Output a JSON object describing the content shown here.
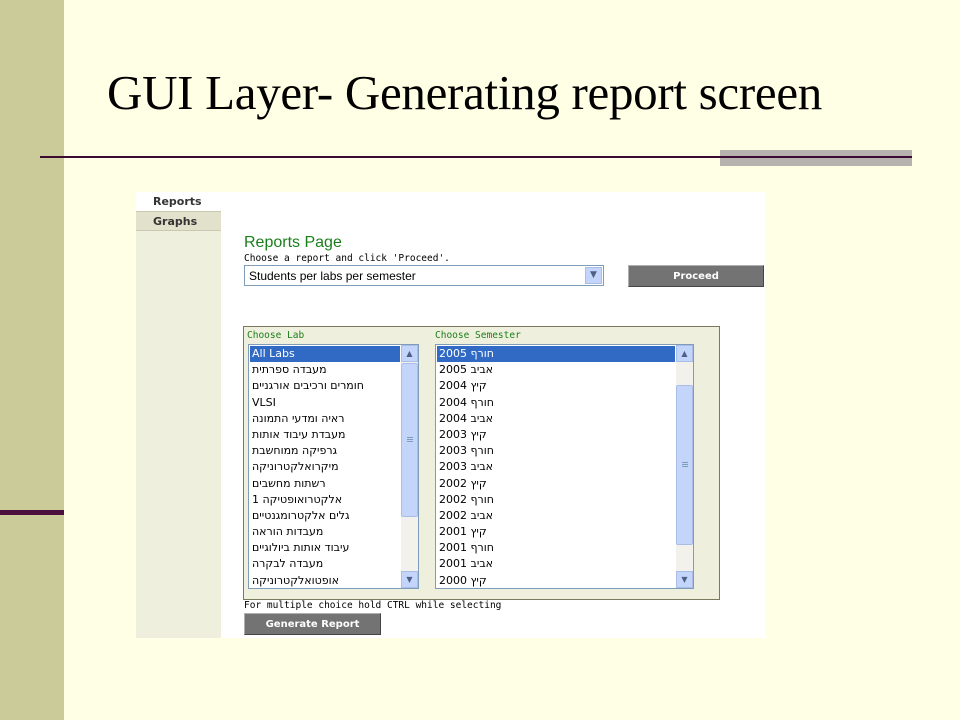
{
  "slide": {
    "title": "GUI Layer- Generating report screen"
  },
  "sidebar": {
    "items": [
      {
        "label": "Reports"
      },
      {
        "label": "Graphs"
      }
    ]
  },
  "main": {
    "heading": "Reports Page",
    "instruction": "Choose a report and click 'Proceed'.",
    "report_select": {
      "value": "Students per labs per semester"
    },
    "proceed_label": "Proceed",
    "filters": {
      "lab_label": "Choose Lab",
      "semester_label": "Choose Semester",
      "labs": [
        "All Labs",
        "מעבדה ספרתית",
        "חומרים ורכיבים אורגניים",
        "VLSI",
        "ראיה ומדעי התמונה",
        "מעבדת עיבוד אותות",
        "גרפיקה ממוחשבת",
        "מיקרואלקטרוניקה",
        "רשתות מחשבים",
        "אלקטרואופטיקה 1",
        "גלים אלקטרומגנטיים",
        "מעבדות הוראה",
        "עיבוד אותות ביולוגיים",
        "מעבדה לבקרה",
        "אופטואלקטרוניקה"
      ],
      "selected_lab": "All Labs",
      "semesters": [
        "חורף 2005",
        "אביב 2005",
        "קיץ 2004",
        "חורף 2004",
        "אביב 2004",
        "קיץ 2003",
        "חורף 2003",
        "אביב 2003",
        "קיץ 2002",
        "חורף 2002",
        "אביב 2002",
        "קיץ 2001",
        "חורף 2001",
        "אביב 2001",
        "קיץ 2000"
      ],
      "selected_semester": "חורף 2005"
    },
    "hint": "For multiple choice hold CTRL while selecting",
    "generate_label": "Generate Report"
  },
  "icons": {
    "dropdown": "chevron-down-icon",
    "scroll_up": "arrow-up-icon",
    "scroll_down": "arrow-down-icon"
  },
  "colors": {
    "slide_background": "#ffffe5",
    "left_band": "#cbcb99",
    "band_accent": "#4a0f3c",
    "heading_green": "#1a7f1a",
    "selection_blue": "#316ac5",
    "button_gray": "#737373",
    "panel_background": "#efefdd"
  }
}
